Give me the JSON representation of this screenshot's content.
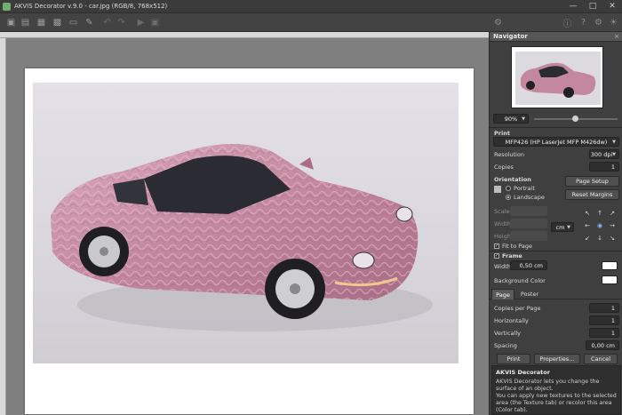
{
  "window": {
    "title": "AKVIS Decorator v.9.0 - car.jpg (RGB/8, 768x512)"
  },
  "navigator": {
    "title": "Navigator",
    "zoom": "90%"
  },
  "print": {
    "title": "Print",
    "printer": "MFP426 (HP LaserJet MFP M426dw)",
    "resolution_label": "Resolution",
    "resolution": "300 dpi",
    "copies_label": "Copies",
    "copies": "1",
    "orientation_label": "Orientation",
    "portrait": "Portrait",
    "landscape": "Landscape",
    "page_setup": "Page Setup",
    "reset_margins": "Reset Margins",
    "scale_label": "Scale",
    "width_label": "Width",
    "height_label": "Height",
    "unit": "cm",
    "fit_to_page": "Fit to Page"
  },
  "frame": {
    "title": "Frame",
    "width_label": "Width",
    "width": "0,50 cm",
    "bg_label": "Background Color"
  },
  "tabs": {
    "page": "Page",
    "poster": "Poster"
  },
  "page_tab": {
    "copies_per_page_label": "Copies per Page",
    "copies_per_page": "1",
    "horizontally_label": "Horizontally",
    "horizontally": "1",
    "vertically_label": "Vertically",
    "vertically": "1",
    "spacing_label": "Spacing",
    "spacing": "0,00 cm"
  },
  "actions": {
    "print": "Print",
    "properties": "Properties...",
    "cancel": "Cancel"
  },
  "info": {
    "title": "AKVIS Decorator",
    "line1": "AKVIS Decorator lets you change the surface of an object.",
    "line2": "You can apply new textures to the selected area (the Texture tab) or recolor this area (Color tab)."
  },
  "colors": {
    "panel": "#3f3f3f",
    "canvas": "#7f7f7f",
    "car": "#c98fa6"
  }
}
